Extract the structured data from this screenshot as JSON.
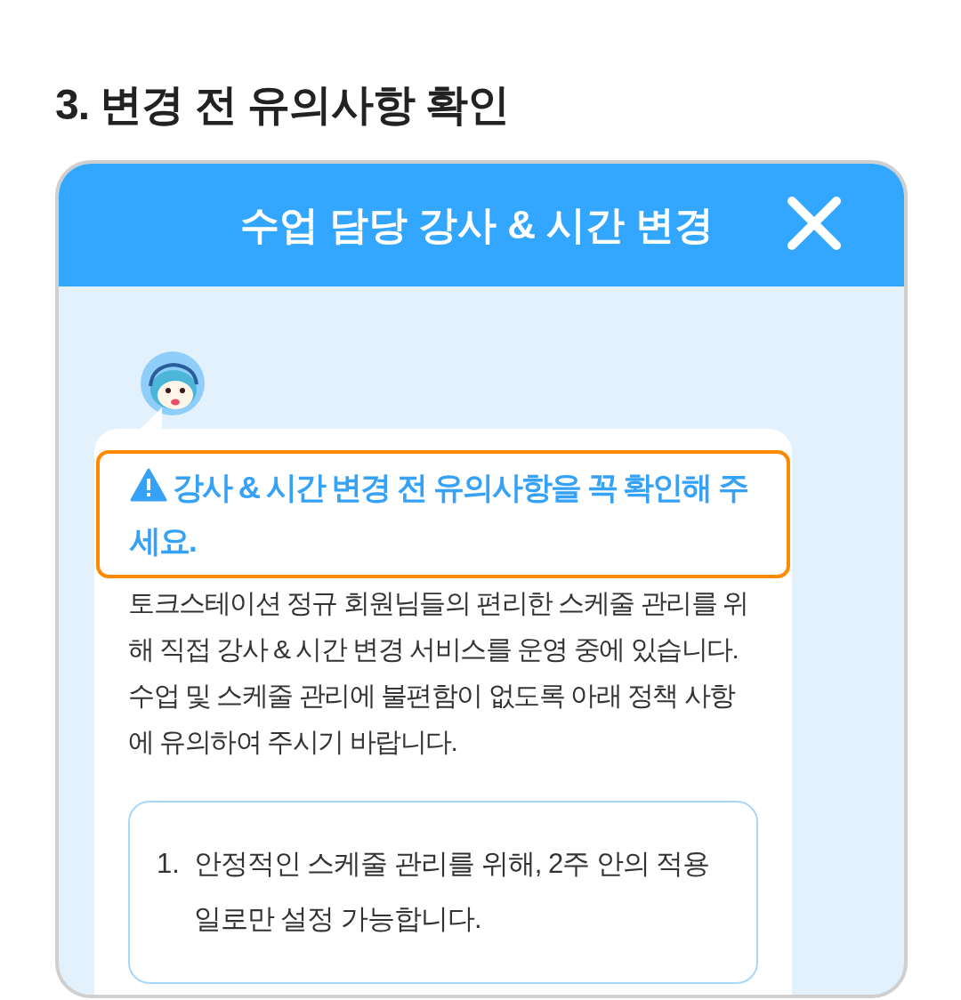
{
  "heading": "3. 변경 전 유의사항 확인",
  "modal": {
    "title": "수업 담당 강사 & 시간 변경",
    "alert": "강사 & 시간 변경 전 유의사항을 꼭 확인해 주세요.",
    "paragraphs": [
      "토크스테이션 정규 회원님들의 편리한 스케줄 관리를 위해 직접 강사 & 시간 변경 서비스를 운영 중에 있습니다.",
      "수업 및 스케줄 관리에 불편함이 없도록 아래 정책 사항에 유의하여 주시기 바랍니다."
    ],
    "notices": [
      {
        "number": "1.",
        "text": "안정적인 스케줄 관리를 위해, 2주 안의 적용일로만 설정 가능합니다."
      }
    ]
  }
}
